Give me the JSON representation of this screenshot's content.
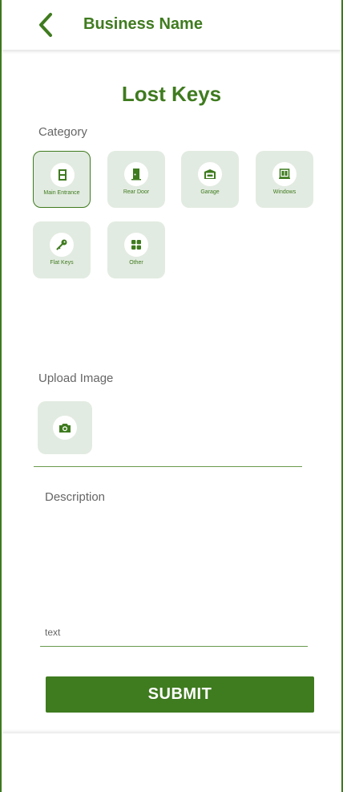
{
  "header": {
    "business_name": "Business Name",
    "back_icon": "chevron-left-icon"
  },
  "page": {
    "title": "Lost Keys"
  },
  "category": {
    "label": "Category",
    "selected": "Main Entrance",
    "items": [
      {
        "label": "Main Entrance",
        "icon": "main-entrance-door-icon"
      },
      {
        "label": "Rear Door",
        "icon": "rear-door-icon"
      },
      {
        "label": "Garage",
        "icon": "garage-icon"
      },
      {
        "label": "Windows",
        "icon": "window-icon"
      },
      {
        "label": "Flat Keys",
        "icon": "key-icon"
      },
      {
        "label": "Other",
        "icon": "grid-icon"
      }
    ]
  },
  "upload": {
    "label": "Upload Image",
    "icon": "camera-icon"
  },
  "description": {
    "label": "Description",
    "placeholder": "text",
    "value": ""
  },
  "submit": {
    "label": "SUBMIT"
  },
  "colors": {
    "primary": "#3f7b1f",
    "tile_bg": "#e2ebe1",
    "muted_text": "#666666"
  }
}
